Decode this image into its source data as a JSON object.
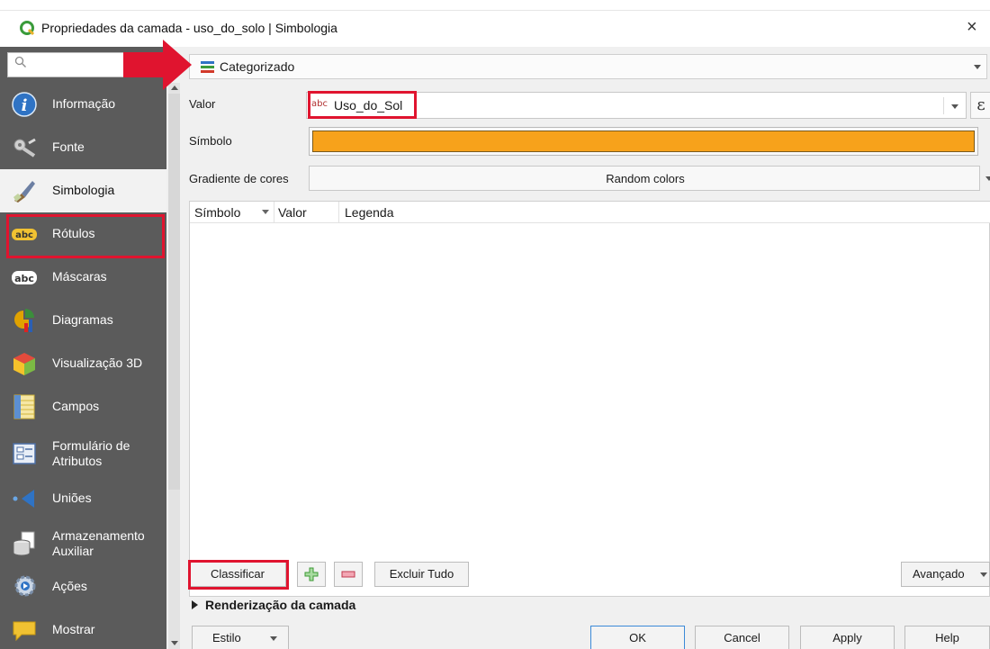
{
  "window": {
    "title": "Propriedades da camada - uso_do_solo | Simbologia",
    "close_glyph": "×"
  },
  "sidebar": {
    "search_placeholder": "",
    "items": [
      {
        "label": "Informação",
        "icon": "info-icon"
      },
      {
        "label": "Fonte",
        "icon": "source-icon"
      },
      {
        "label": "Simbologia",
        "icon": "paintbrush-icon",
        "selected": true
      },
      {
        "label": "Rótulos",
        "icon": "labels-icon"
      },
      {
        "label": "Máscaras",
        "icon": "masks-icon"
      },
      {
        "label": "Diagramas",
        "icon": "diagrams-icon"
      },
      {
        "label": "Visualização 3D",
        "icon": "cube-3d-icon"
      },
      {
        "label": "Campos",
        "icon": "fields-icon"
      },
      {
        "label": "Formulário de Atributos",
        "icon": "form-icon"
      },
      {
        "label": "Uniões",
        "icon": "joins-icon"
      },
      {
        "label": "Armazenamento Auxiliar",
        "icon": "storage-icon"
      },
      {
        "label": "Ações",
        "icon": "actions-icon"
      },
      {
        "label": "Mostrar",
        "icon": "display-icon"
      }
    ]
  },
  "symbology": {
    "renderer": "Categorizado",
    "valor_label": "Valor",
    "valor_type_badge": "abc",
    "valor_value": "Uso_do_Sol",
    "expression_glyph": "ε",
    "simbolo_label": "Símbolo",
    "symbol_color": "#f7a21b",
    "gradient_label": "Gradiente de cores",
    "gradient_value": "Random colors",
    "table_headers": [
      "Símbolo",
      "Valor",
      "Legenda"
    ],
    "table_rows": []
  },
  "buttons": {
    "classify": "Classificar",
    "delete_all": "Excluir Tudo",
    "advanced": "Avançado",
    "style": "Estilo",
    "ok": "OK",
    "cancel": "Cancel",
    "apply": "Apply",
    "help": "Help"
  },
  "layer_rendering": {
    "label": "Renderização da camada"
  },
  "colors": {
    "sidebar_bg": "#5b5b5b",
    "highlight": "#e0142f",
    "symbol_fill": "#f7a21b"
  }
}
